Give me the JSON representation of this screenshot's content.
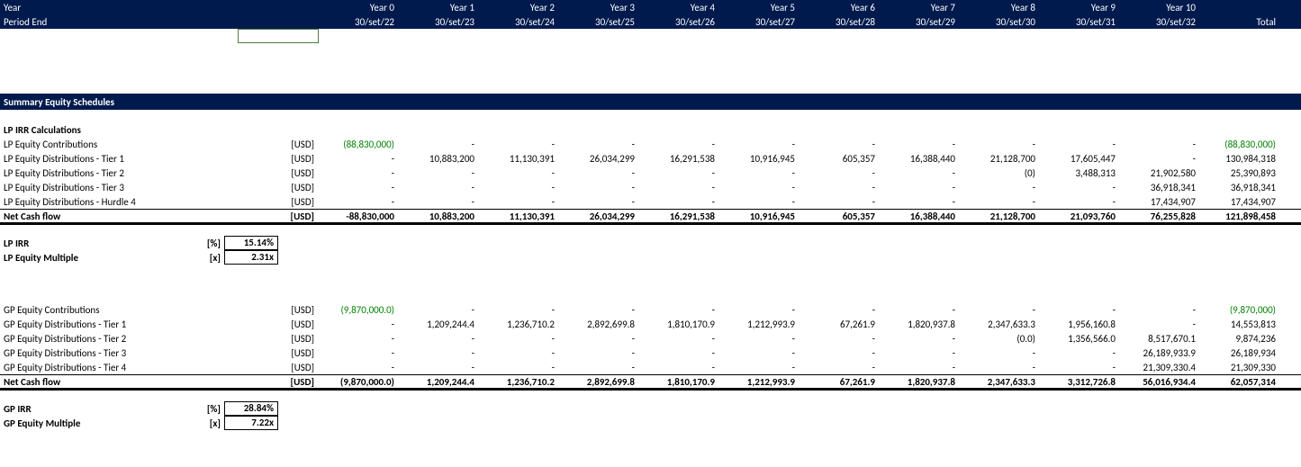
{
  "header": {
    "year_label": "Year",
    "period_label": "Period End",
    "years": [
      "Year 0",
      "Year 1",
      "Year 2",
      "Year 3",
      "Year 4",
      "Year 5",
      "Year 6",
      "Year 7",
      "Year 8",
      "Year 9",
      "Year 10",
      ""
    ],
    "dates": [
      "30/set/22",
      "30/set/23",
      "30/set/24",
      "30/set/25",
      "30/set/26",
      "30/set/27",
      "30/set/28",
      "30/set/29",
      "30/set/30",
      "30/set/31",
      "30/set/32",
      "Total"
    ]
  },
  "section_title": "Summary Equity Schedules",
  "lp": {
    "title": "LP IRR Calculations",
    "rows": [
      {
        "label": "LP Equity Contributions",
        "unit": "[USD]",
        "vals": [
          "(88,830,000)",
          "-",
          "-",
          "-",
          "-",
          "-",
          "-",
          "-",
          "-",
          "-",
          "-",
          "(88,830,000)"
        ],
        "neg0": true,
        "neg11": true
      },
      {
        "label": "LP Equity Distributions - Tier 1",
        "unit": "[USD]",
        "vals": [
          "-",
          "10,883,200",
          "11,130,391",
          "26,034,299",
          "16,291,538",
          "10,916,945",
          "605,357",
          "16,388,440",
          "21,128,700",
          "17,605,447",
          "-",
          "130,984,318"
        ]
      },
      {
        "label": "LP Equity Distributions - Tier 2",
        "unit": "[USD]",
        "vals": [
          "-",
          "-",
          "-",
          "-",
          "-",
          "-",
          "-",
          "-",
          "(0)",
          "3,488,313",
          "21,902,580",
          "25,390,893"
        ]
      },
      {
        "label": "LP Equity Distributions - Tier 3",
        "unit": "[USD]",
        "vals": [
          "-",
          "-",
          "-",
          "-",
          "-",
          "-",
          "-",
          "-",
          "-",
          "-",
          "36,918,341",
          "36,918,341"
        ]
      },
      {
        "label": "LP Equity Distributions - Hurdle 4",
        "unit": "[USD]",
        "vals": [
          "-",
          "-",
          "-",
          "-",
          "-",
          "-",
          "-",
          "-",
          "-",
          "-",
          "17,434,907",
          "17,434,907"
        ]
      }
    ],
    "net": {
      "label": "Net Cash flow",
      "unit": "[USD]",
      "vals": [
        "-88,830,000",
        "10,883,200",
        "11,130,391",
        "26,034,299",
        "16,291,538",
        "10,916,945",
        "605,357",
        "16,388,440",
        "21,128,700",
        "21,093,760",
        "76,255,828",
        "121,898,458"
      ]
    },
    "irr_label": "LP IRR",
    "irr_unit": "[%]",
    "irr_val": "15.14%",
    "mult_label": "LP Equity Multiple",
    "mult_unit": "[x]",
    "mult_val": "2.31x"
  },
  "gp": {
    "rows": [
      {
        "label": "GP Equity Contributions",
        "unit": "[USD]",
        "vals": [
          "(9,870,000.0)",
          "-",
          "-",
          "-",
          "-",
          "-",
          "-",
          "-",
          "-",
          "-",
          "-",
          "(9,870,000)"
        ],
        "neg0": true,
        "neg11": true
      },
      {
        "label": "GP Equity Distributions - Tier 1",
        "unit": "[USD]",
        "vals": [
          "-",
          "1,209,244.4",
          "1,236,710.2",
          "2,892,699.8",
          "1,810,170.9",
          "1,212,993.9",
          "67,261.9",
          "1,820,937.8",
          "2,347,633.3",
          "1,956,160.8",
          "-",
          "14,553,813"
        ]
      },
      {
        "label": "GP Equity Distributions - Tier 2",
        "unit": "[USD]",
        "vals": [
          "-",
          "-",
          "-",
          "-",
          "-",
          "-",
          "-",
          "-",
          "(0.0)",
          "1,356,566.0",
          "8,517,670.1",
          "9,874,236"
        ]
      },
      {
        "label": "GP Equity Distributions - Tier 3",
        "unit": "[USD]",
        "vals": [
          "-",
          "-",
          "-",
          "-",
          "-",
          "-",
          "-",
          "-",
          "-",
          "-",
          "26,189,933.9",
          "26,189,934"
        ]
      },
      {
        "label": "GP Equity Distributions - Tier 4",
        "unit": "[USD]",
        "vals": [
          "-",
          "-",
          "-",
          "-",
          "-",
          "-",
          "-",
          "-",
          "-",
          "-",
          "21,309,330.4",
          "21,309,330"
        ]
      }
    ],
    "net": {
      "label": "Net Cash flow",
      "unit": "[USD]",
      "vals": [
        "(9,870,000.0)",
        "1,209,244.4",
        "1,236,710.2",
        "2,892,699.8",
        "1,810,170.9",
        "1,212,993.9",
        "67,261.9",
        "1,820,937.8",
        "2,347,633.3",
        "3,312,726.8",
        "56,016,934.4",
        "62,057,314"
      ]
    },
    "irr_label": "GP IRR",
    "irr_unit": "[%]",
    "irr_val": "28.84%",
    "mult_label": "GP Equity Multiple",
    "mult_unit": "[x]",
    "mult_val": "7.22x"
  }
}
